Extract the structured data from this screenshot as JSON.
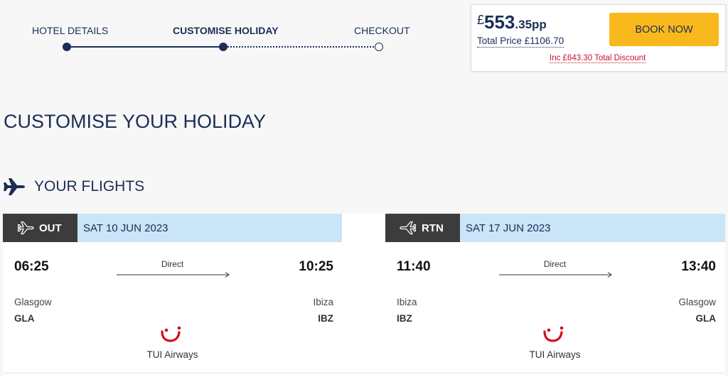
{
  "progress": {
    "steps": [
      {
        "label": "HOTEL DETAILS",
        "state": "done"
      },
      {
        "label": "CUSTOMISE HOLIDAY",
        "state": "active"
      },
      {
        "label": "CHECKOUT",
        "state": "pending"
      }
    ]
  },
  "price": {
    "currency": "£",
    "integer": "553",
    "decimal": ".35pp",
    "total": "Total Price £1106.70",
    "discount": "Inc £643.30 Total Discount",
    "book_label": "BOOK NOW"
  },
  "page_title": "CUSTOMISE YOUR HOLIDAY",
  "flights_section": {
    "title": "YOUR FLIGHTS",
    "icon": "plane-icon"
  },
  "flights": {
    "outbound": {
      "badge": "OUT",
      "date": "SAT 10 JUN 2023",
      "dep_time": "06:25",
      "arr_time": "10:25",
      "stops": "Direct",
      "dep_city": "Glasgow",
      "dep_code": "GLA",
      "arr_city": "Ibiza",
      "arr_code": "IBZ",
      "airline": "TUI Airways"
    },
    "return": {
      "badge": "RTN",
      "date": "SAT 17 JUN 2023",
      "dep_time": "11:40",
      "arr_time": "13:40",
      "stops": "Direct",
      "dep_city": "Ibiza",
      "dep_code": "IBZ",
      "arr_city": "Glasgow",
      "arr_code": "GLA",
      "airline": "TUI Airways"
    }
  },
  "colors": {
    "navy": "#1b2e55",
    "accent_yellow": "#f9b91c",
    "discount_red": "#c8102e",
    "header_blue": "#c9e5f7",
    "badge_dark": "#3c3c3c"
  }
}
